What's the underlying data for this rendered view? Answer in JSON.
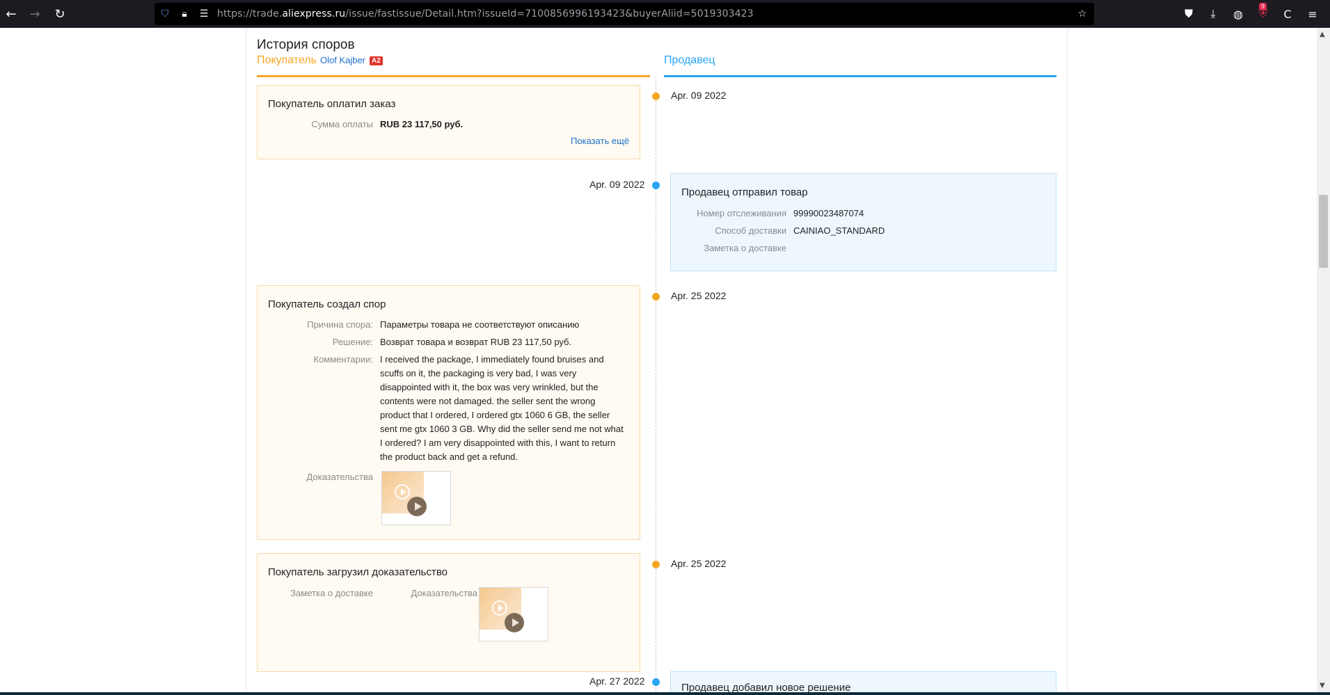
{
  "browser": {
    "url_prefix": "https://trade.",
    "url_domain": "aliexpress.ru",
    "url_path": "/issue/fastissue/Detail.htm?issueId=7100856996193423&buyerAliid=5019303423",
    "extensions_badge": "9"
  },
  "page": {
    "title": "История споров",
    "buyer_column": {
      "label": "Покупатель",
      "buyer_name": "Olof Kajber",
      "level": "A2"
    },
    "seller_column": {
      "label": "Продавец"
    }
  },
  "events": [
    {
      "side": "buyer",
      "date": "Apr. 09 2022",
      "title": "Покупатель оплатил заказ",
      "fields": [
        {
          "key": "Сумма оплаты",
          "value": "RUB 23 117,50 руб."
        }
      ],
      "more_link": "Показать ещё"
    },
    {
      "side": "seller",
      "date": "Apr. 09 2022",
      "title": "Продавец отправил товар",
      "fields": [
        {
          "key": "Номер отслеживания",
          "value": "99990023487074"
        },
        {
          "key": "Способ доставки",
          "value": "CAINIAO_STANDARD"
        },
        {
          "key": "Заметка о доставке",
          "value": ""
        }
      ]
    },
    {
      "side": "buyer",
      "date": "Apr. 25 2022",
      "title": "Покупатель создал спор",
      "fields": [
        {
          "key": "Причина спора:",
          "value": "Параметры товара не соответствуют описанию"
        },
        {
          "key": "Решение:",
          "value": "Возврат товара и возврат RUB 23 117,50 руб."
        },
        {
          "key": "Комментарии:",
          "value": "I received the package, I immediately found bruises and scuffs on it, the packaging is very bad, I was very disappointed with it, the box was very wrinkled, but the contents were not damaged. the seller sent the wrong product that I ordered, I ordered gtx 1060 6 GB, the seller sent me gtx 1060 3 GB. Why did the seller send me not what I ordered? I am very disappointed with this, I want to return the product back and get a refund."
        },
        {
          "key": "Доказательства",
          "value": ""
        }
      ]
    },
    {
      "side": "buyer",
      "date": "Apr. 25 2022",
      "title": "Покупатель загрузил доказательство",
      "fields": [
        {
          "key": "Заметка о доставке",
          "value": ""
        },
        {
          "key": "Доказательства",
          "value": ""
        }
      ]
    },
    {
      "side": "seller",
      "date": "Apr. 27 2022",
      "title": "Продавец добавил новое решение",
      "fields": []
    }
  ],
  "colors": {
    "buyer_accent": "#f5a623",
    "seller_accent": "#2aa4f4",
    "link": "#1d6fc9"
  }
}
